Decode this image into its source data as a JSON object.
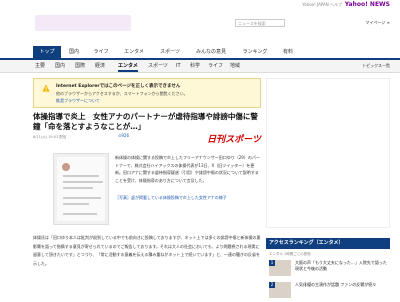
{
  "topbar": {
    "util_text": "Yahoo! JAPAN ヘルプ",
    "logo": "Yahoo! NEWS"
  },
  "header": {
    "search_placeholder": "ニュースを検索",
    "links": "マイページ ≡"
  },
  "nav_primary": [
    {
      "label": "トップ",
      "active": true
    },
    {
      "label": "国内",
      "active": false
    },
    {
      "label": "ライフ",
      "active": false
    },
    {
      "label": "エンタメ",
      "active": false
    },
    {
      "label": "スポーツ",
      "active": false
    },
    {
      "label": "みんなの意見",
      "active": false
    },
    {
      "label": "ランキング",
      "active": false
    },
    {
      "label": "有料",
      "active": false
    }
  ],
  "nav_secondary": [
    {
      "label": "主要",
      "active": false
    },
    {
      "label": "国内",
      "active": false
    },
    {
      "label": "国際",
      "active": false
    },
    {
      "label": "経済",
      "active": false
    },
    {
      "label": "エンタメ",
      "active": true
    },
    {
      "label": "スポーツ",
      "active": false
    },
    {
      "label": "IT",
      "active": false
    },
    {
      "label": "科学",
      "active": false
    },
    {
      "label": "ライフ",
      "active": false
    },
    {
      "label": "地域",
      "active": false
    }
  ],
  "nav_secondary_right": "トピックス一覧",
  "notice": {
    "title": "Internet Explorerではこのページを正しく表示できません",
    "line2": "他のブラウザーからアクセスするか、スマートフォンから閲覧ください。",
    "link": "推奨ブラウザーについて"
  },
  "article": {
    "headline": "体操指導で炎上　女性アナのパートナーが虐待指導や誹謗中傷に警鐘「命を落とすようなことが…」",
    "meta": "8/11(火) 19:03 配信",
    "shares": "⊙926",
    "source": "日刊スポーツ",
    "body1": "新体操の体操に関する投稿で炎上したフリーアナウンサー田口ゆり（29）のパートナーで、株式会社ハイアックスの体操代表が13日、X（旧ツイッター）を更新。田口アナに関する虐待指導疑惑（引用）や誹謗中傷の状況について説明することを受け、体操指導のあり方について言及した。",
    "caption": "［写真］虚が掲載している体操投稿で炎上した女性アナの様子",
    "body2": "体操氏は「田口ゆり本人は批判が殺到している中でも前向きに投稿しておりますが、ネット上では多くの誹謗中傷と新体操の悪影響を語って指摘する意見が寄せられているのでご報告しております。それは大人の社会においても、より問題視される現実に留意して頂きたいです」とつづり、「常に活動する意義を伝える積み重ねがネット上で続いています」と、一連の騒ぎの反省を示した。"
  },
  "sidebar": {
    "ranking_title": "アクセスランキング（エンタメ）",
    "ranking_sub": "エンタメ 1時間ごとの更新",
    "items": [
      {
        "rank": "1",
        "text": "大阪の声「もう大丈夫になった…」入院先で語った現状と今後の活動"
      },
      {
        "rank": "2",
        "text": "人気俳優の主演作が話題 ファンの反響が続々"
      }
    ]
  }
}
